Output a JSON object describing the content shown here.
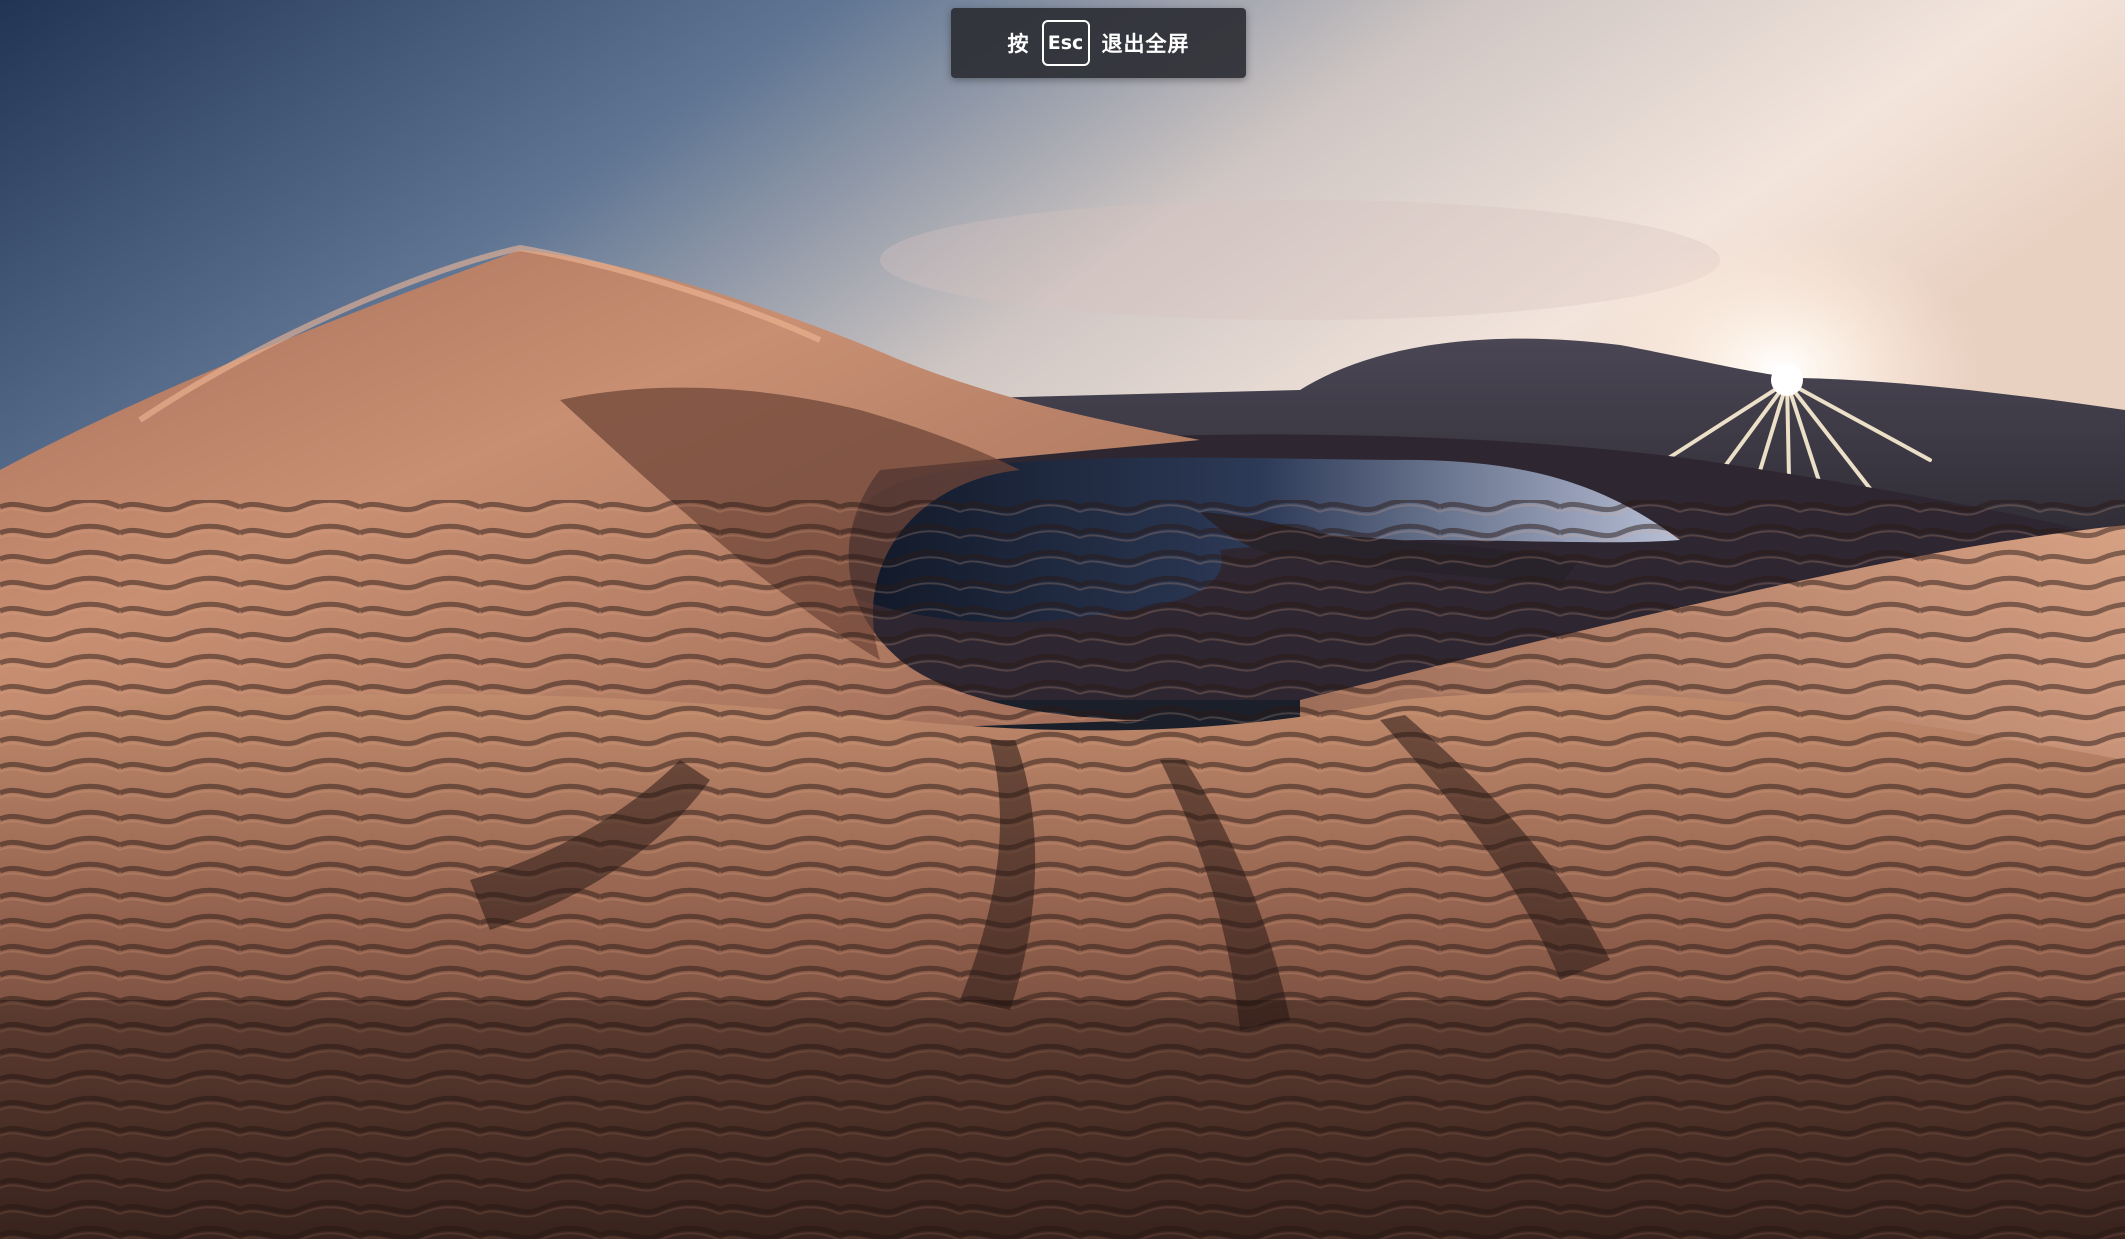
{
  "photo": {
    "icon": "fullscreen-photo-desert-dunes-lake-sunset"
  },
  "toast": {
    "prefix": "按",
    "key": "Esc",
    "suffix": "退出全屏"
  },
  "colors": {
    "toast_bg": "#2c2e34",
    "toast_text": "#ffffff",
    "sand_light": "#c99474",
    "sand_dark": "#3a2621",
    "water": "#1a2336",
    "sky_top": "#2a3a56"
  }
}
